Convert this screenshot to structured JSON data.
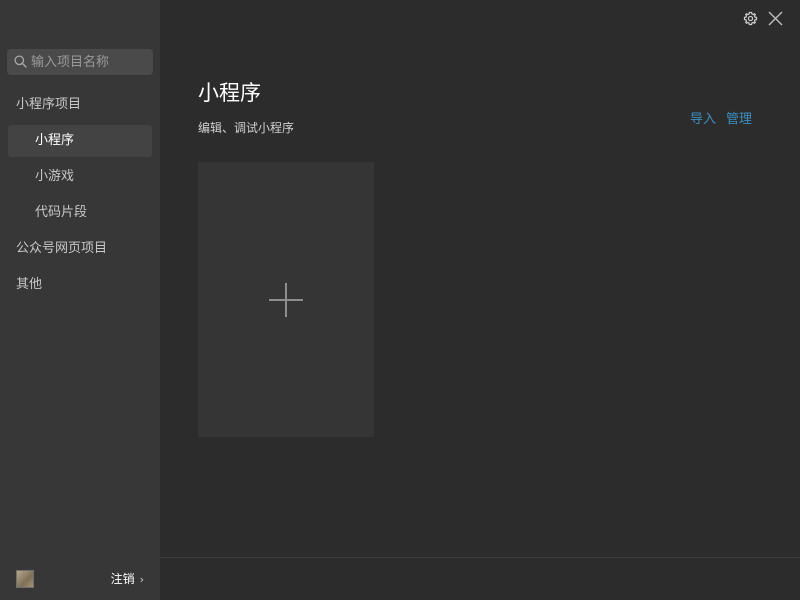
{
  "sidebar": {
    "search": {
      "placeholder": "输入项目名称",
      "value": ""
    },
    "groups": [
      {
        "label": "小程序项目",
        "items": [
          {
            "label": "小程序",
            "active": true
          },
          {
            "label": "小游戏",
            "active": false
          },
          {
            "label": "代码片段",
            "active": false
          }
        ]
      },
      {
        "label": "公众号网页项目"
      },
      {
        "label": "其他"
      }
    ],
    "footer": {
      "logout_label": "注销",
      "chevron": "›"
    }
  },
  "main": {
    "title": "小程序",
    "subtitle": "编辑、调试小程序",
    "actions": {
      "import_label": "导入",
      "manage_label": "管理"
    },
    "new_card_icon": "plus-icon"
  },
  "icons": {
    "search": "search-icon",
    "settings": "gear-icon",
    "close": "close-icon",
    "avatar": "avatar"
  },
  "colors": {
    "sidebar_bg": "#373737",
    "main_bg": "#2c2c2c",
    "active_item_bg": "#434343",
    "link": "#3d8fc0",
    "card_bg": "#353535"
  }
}
